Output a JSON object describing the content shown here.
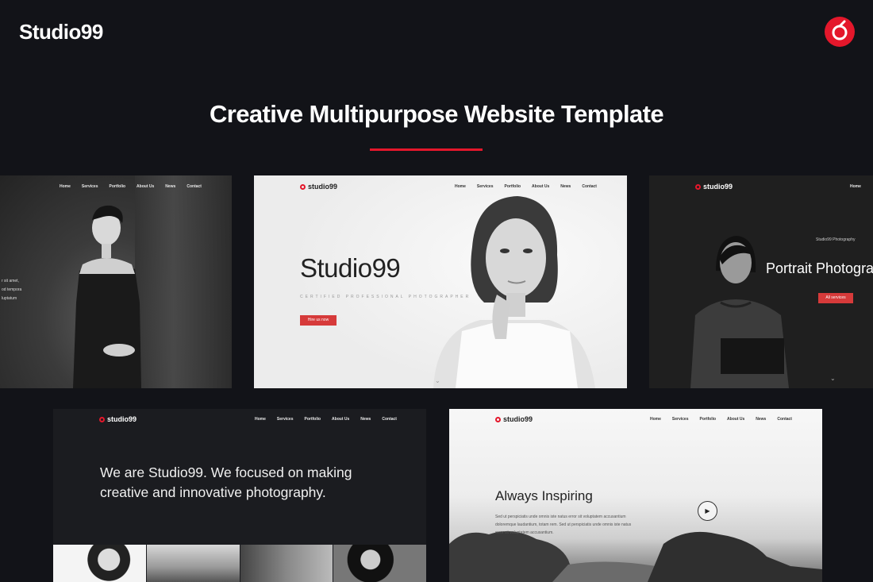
{
  "header": {
    "brand": "Studio99",
    "headline": "Creative Multipurpose Website Template"
  },
  "colors": {
    "background": "#121318",
    "accent": "#e4172b",
    "button": "#d63a3a"
  },
  "previews": {
    "nav_items": [
      "Home",
      "Services",
      "Portfolio",
      "About Us",
      "News",
      "Contact"
    ],
    "logo": "studio99",
    "logo_icon": "flower-logo-icon",
    "shot1": {
      "nav_items": [
        "Home",
        "Services",
        "Portfolio",
        "About Us",
        "News",
        "Contact"
      ],
      "partial_text": [
        "r sit amet,",
        "od tempora",
        "luptatum"
      ]
    },
    "shot2": {
      "title": "Studio99",
      "subtitle": "CERTIFIED PROFESSIONAL PHOTOGRAPHER",
      "button": "Hire us now"
    },
    "shot3": {
      "nav_first": "Home",
      "kicker": "Studio99 Photography",
      "title": "Portrait Photogra",
      "button": "All services"
    },
    "shot4": {
      "about": "We are Studio99. We focused on making creative and innovative photography."
    },
    "shot5": {
      "title": "Always Inspiring",
      "body": "Sed ut perspiciatis unde omnis iste natus error sit voluptatem accusantium doloremque laudantium, totam rem. Sed ut perspiciatis unde omnis iste natus error sit voluptatem accusantium.",
      "play_icon": "play-icon"
    }
  }
}
